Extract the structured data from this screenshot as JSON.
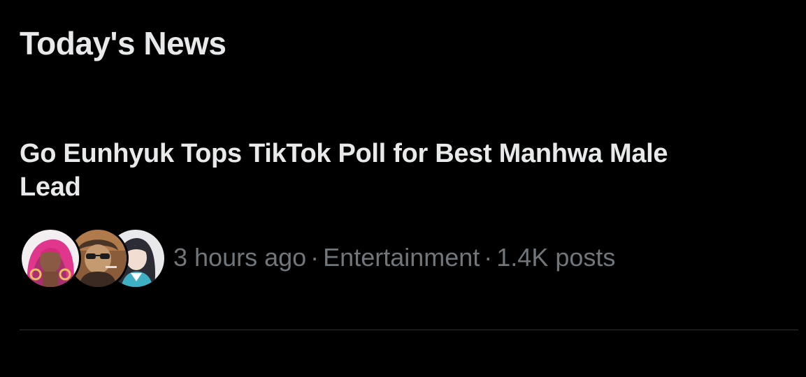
{
  "section": {
    "title": "Today's News"
  },
  "news": {
    "headline": "Go Eunhyuk Tops TikTok Poll for Best Manhwa Male Lead",
    "time_ago": "3 hours ago",
    "separator": "·",
    "category": "Entertainment",
    "posts_count": "1.4K posts",
    "avatars": [
      {
        "icon": "avatar-pink-hair-icon"
      },
      {
        "icon": "avatar-sunglasses-character-icon"
      },
      {
        "icon": "avatar-anime-girl-icon"
      }
    ]
  },
  "colors": {
    "background": "#000000",
    "primary_text": "#e7e9ea",
    "secondary_text": "#71767b",
    "divider": "#2f3336"
  }
}
